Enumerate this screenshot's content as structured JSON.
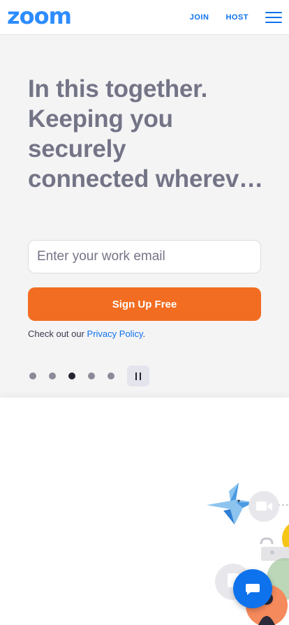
{
  "header": {
    "logo_text": "zoom",
    "join_label": "JOIN",
    "host_label": "HOST",
    "menu_icon": "hamburger-menu-icon"
  },
  "hero": {
    "headline_lines": [
      "In this together.",
      "Keeping you",
      "securely",
      "connected wherev…"
    ],
    "email_placeholder": "Enter your work email",
    "signup_label": "Sign Up Free",
    "privacy_prefix": "Check out our ",
    "privacy_link": "Privacy Policy",
    "privacy_suffix": ".",
    "carousel": {
      "slide_count": 5,
      "active_index": 2,
      "pause_icon": "pause-icon"
    }
  },
  "chat": {
    "icon": "chat-bubble-icon"
  },
  "colors": {
    "brand_blue": "#2d8cff",
    "link_blue": "#0e72ed",
    "cta_orange": "#f26d21",
    "headline_gray": "#747487",
    "hero_bg": "#f4f4f5"
  }
}
